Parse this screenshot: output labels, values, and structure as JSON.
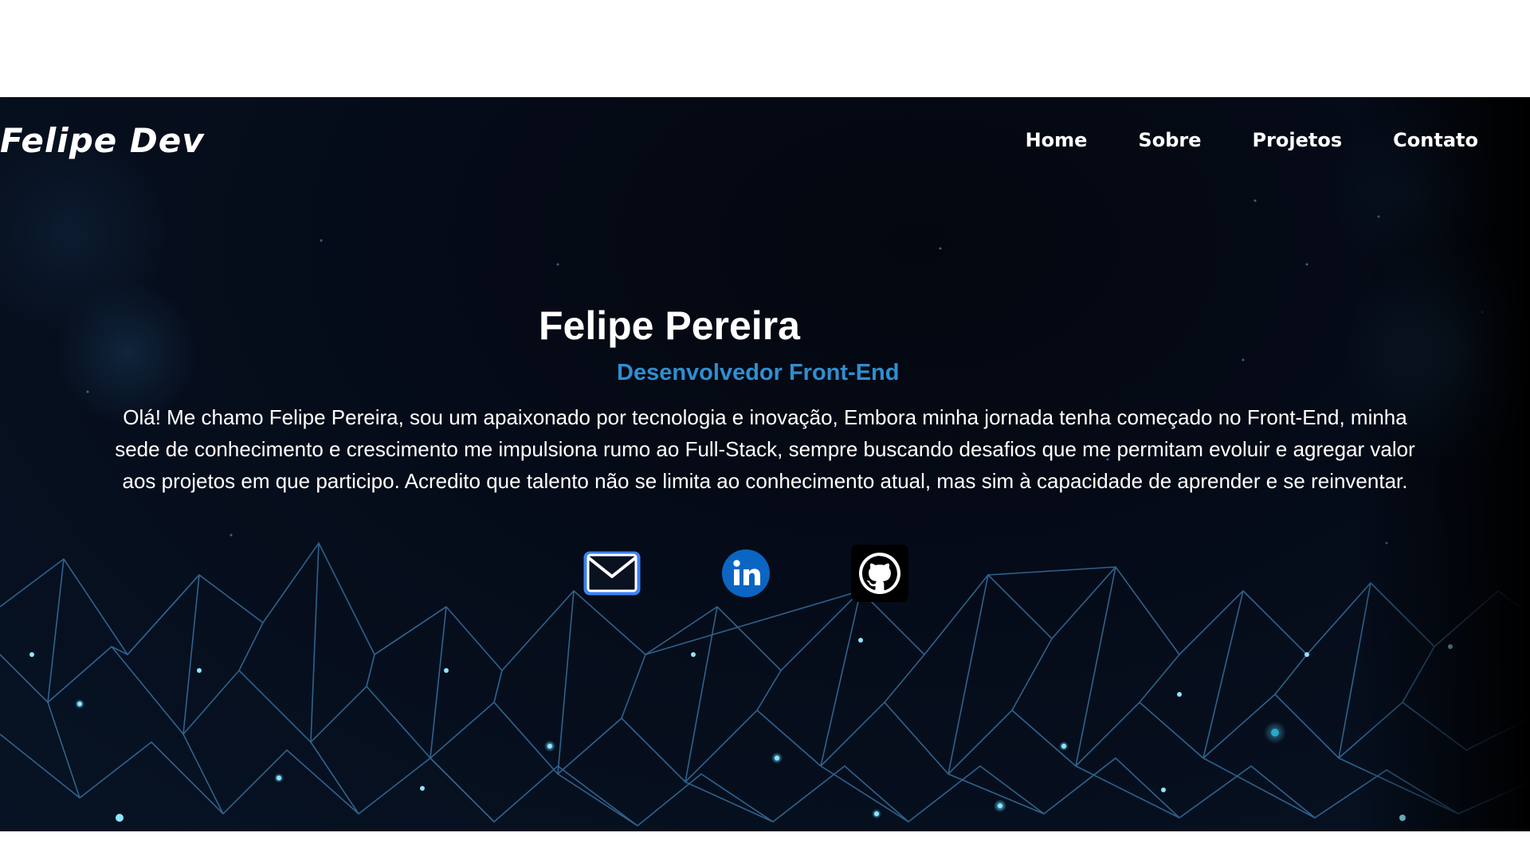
{
  "brand": {
    "logo_text": "Felipe Dev"
  },
  "nav": {
    "items": [
      {
        "label": "Home"
      },
      {
        "label": "Sobre"
      },
      {
        "label": "Projetos"
      },
      {
        "label": "Contato"
      }
    ]
  },
  "hero": {
    "name": "Felipe Pereira",
    "role": "Desenvolvedor Front-End",
    "bio": "Olá! Me chamo Felipe Pereira, sou um apaixonado por tecnologia e inovação, Embora minha jornada tenha começado no Front-End, minha sede de conhecimento e crescimento me impulsiona rumo ao Full-Stack, sempre buscando desafios que me permitam evoluir e agregar valor aos projetos em que participo. Acredito que talento não se limita ao conhecimento atual, mas sim à capacidade de aprender e se reinventar."
  },
  "socials": [
    {
      "icon": "email-icon",
      "color": "#3b82f6"
    },
    {
      "icon": "linkedin-icon",
      "color": "#0a66c2"
    },
    {
      "icon": "github-icon",
      "color": "#000000"
    }
  ],
  "colors": {
    "background": "#050b18",
    "accent": "#2f8fd0",
    "text": "#ffffff"
  }
}
